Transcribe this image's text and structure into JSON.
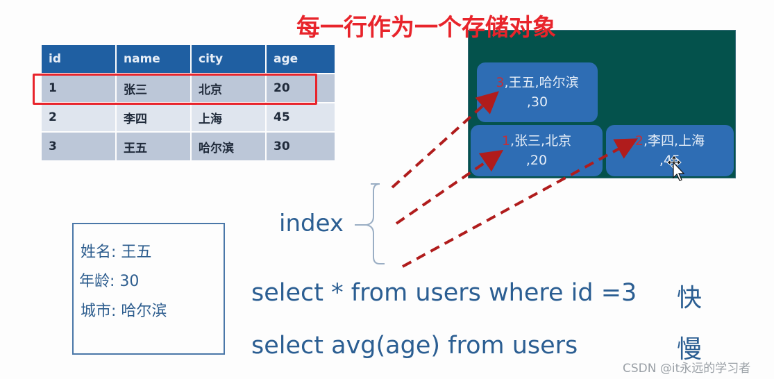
{
  "title": "每一行作为一个存储对象",
  "table": {
    "columns": [
      "id",
      "name",
      "city",
      "age"
    ],
    "rows": [
      [
        "1",
        "张三",
        "北京",
        "20"
      ],
      [
        "2",
        "李四",
        "上海",
        "45"
      ],
      [
        "3",
        "王五",
        "哈尔滨",
        "30"
      ]
    ],
    "highlighted_row": 1
  },
  "storage_objects": [
    {
      "id": "3",
      "line1": ",王五,哈尔滨",
      "line2": ",30"
    },
    {
      "id": "1",
      "line1": ",张三,北京",
      "line2": ",20"
    },
    {
      "id": "2",
      "line1": ",李四,上海",
      "line2": ",45"
    }
  ],
  "index_label": "index",
  "record_card": {
    "lines": [
      "姓名: 王五",
      "年龄: 30",
      "城市: 哈尔滨"
    ]
  },
  "queries": [
    {
      "sql": "select * from users where id =3",
      "speed": "快"
    },
    {
      "sql": "select avg(age) from users",
      "speed": "慢"
    }
  ],
  "watermark": "CSDN @it永远的学习者",
  "colors": {
    "title": "#e8242b",
    "table_header": "#1f5fa2",
    "panel_bg": "#04524c",
    "object_bg": "#2e6db4",
    "arrow": "#b01c1c",
    "text_blue": "#2b5e92"
  }
}
